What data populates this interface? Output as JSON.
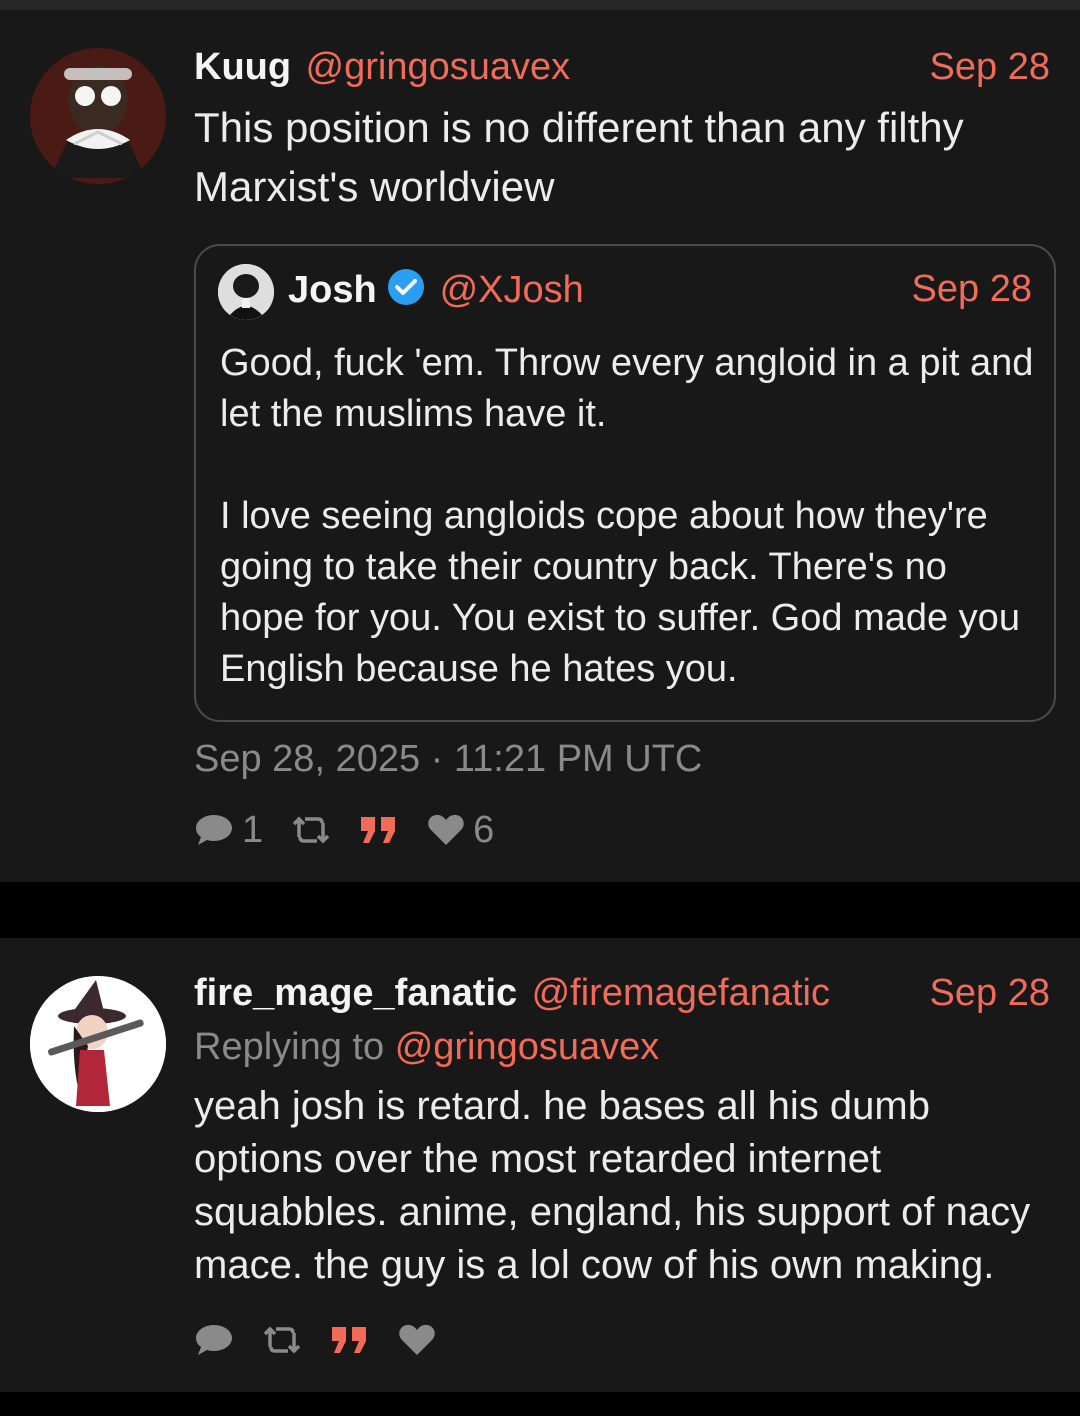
{
  "colors": {
    "background": "#000000",
    "card": "#181818",
    "accent": "#f26a58",
    "muted": "#8a8a8a",
    "verified": "#2a9df4"
  },
  "tweets": [
    {
      "name": "Kuug",
      "handle": "@gringosuavex",
      "date": "Sep 28",
      "text_lines": [
        "This position is no different than any filthy",
        "Marxist's worldview"
      ],
      "quote": {
        "name": "Josh",
        "verified": true,
        "handle": "@XJosh",
        "date": "Sep 28",
        "paragraph1": "Good, fuck 'em. Throw every angloid in a pit and let the muslims have it.",
        "paragraph2": "I love seeing angloids cope about how they're going to take their country back. There's no hope for you. You exist to suffer. God made you English because he hates you."
      },
      "timestamp": "Sep 28, 2025 · 11:21 PM UTC",
      "stats": {
        "replies": "1",
        "likes": "6"
      },
      "icons": [
        "comment-icon",
        "retweet-icon",
        "quote-icon",
        "heart-icon"
      ]
    },
    {
      "name": "fire_mage_fanatic",
      "handle": "@firemagefanatic",
      "date": "Sep 28",
      "replying_label": "Replying to",
      "replying_handle": "@gringosuavex",
      "text_lines": [
        "yeah josh is retard. he bases all his dumb",
        "options over the most retarded internet",
        "squabbles. anime, england, his support of nacy",
        "mace. the guy is a lol cow of his own making."
      ],
      "icons": [
        "comment-icon",
        "retweet-icon",
        "quote-icon",
        "heart-icon"
      ]
    }
  ]
}
